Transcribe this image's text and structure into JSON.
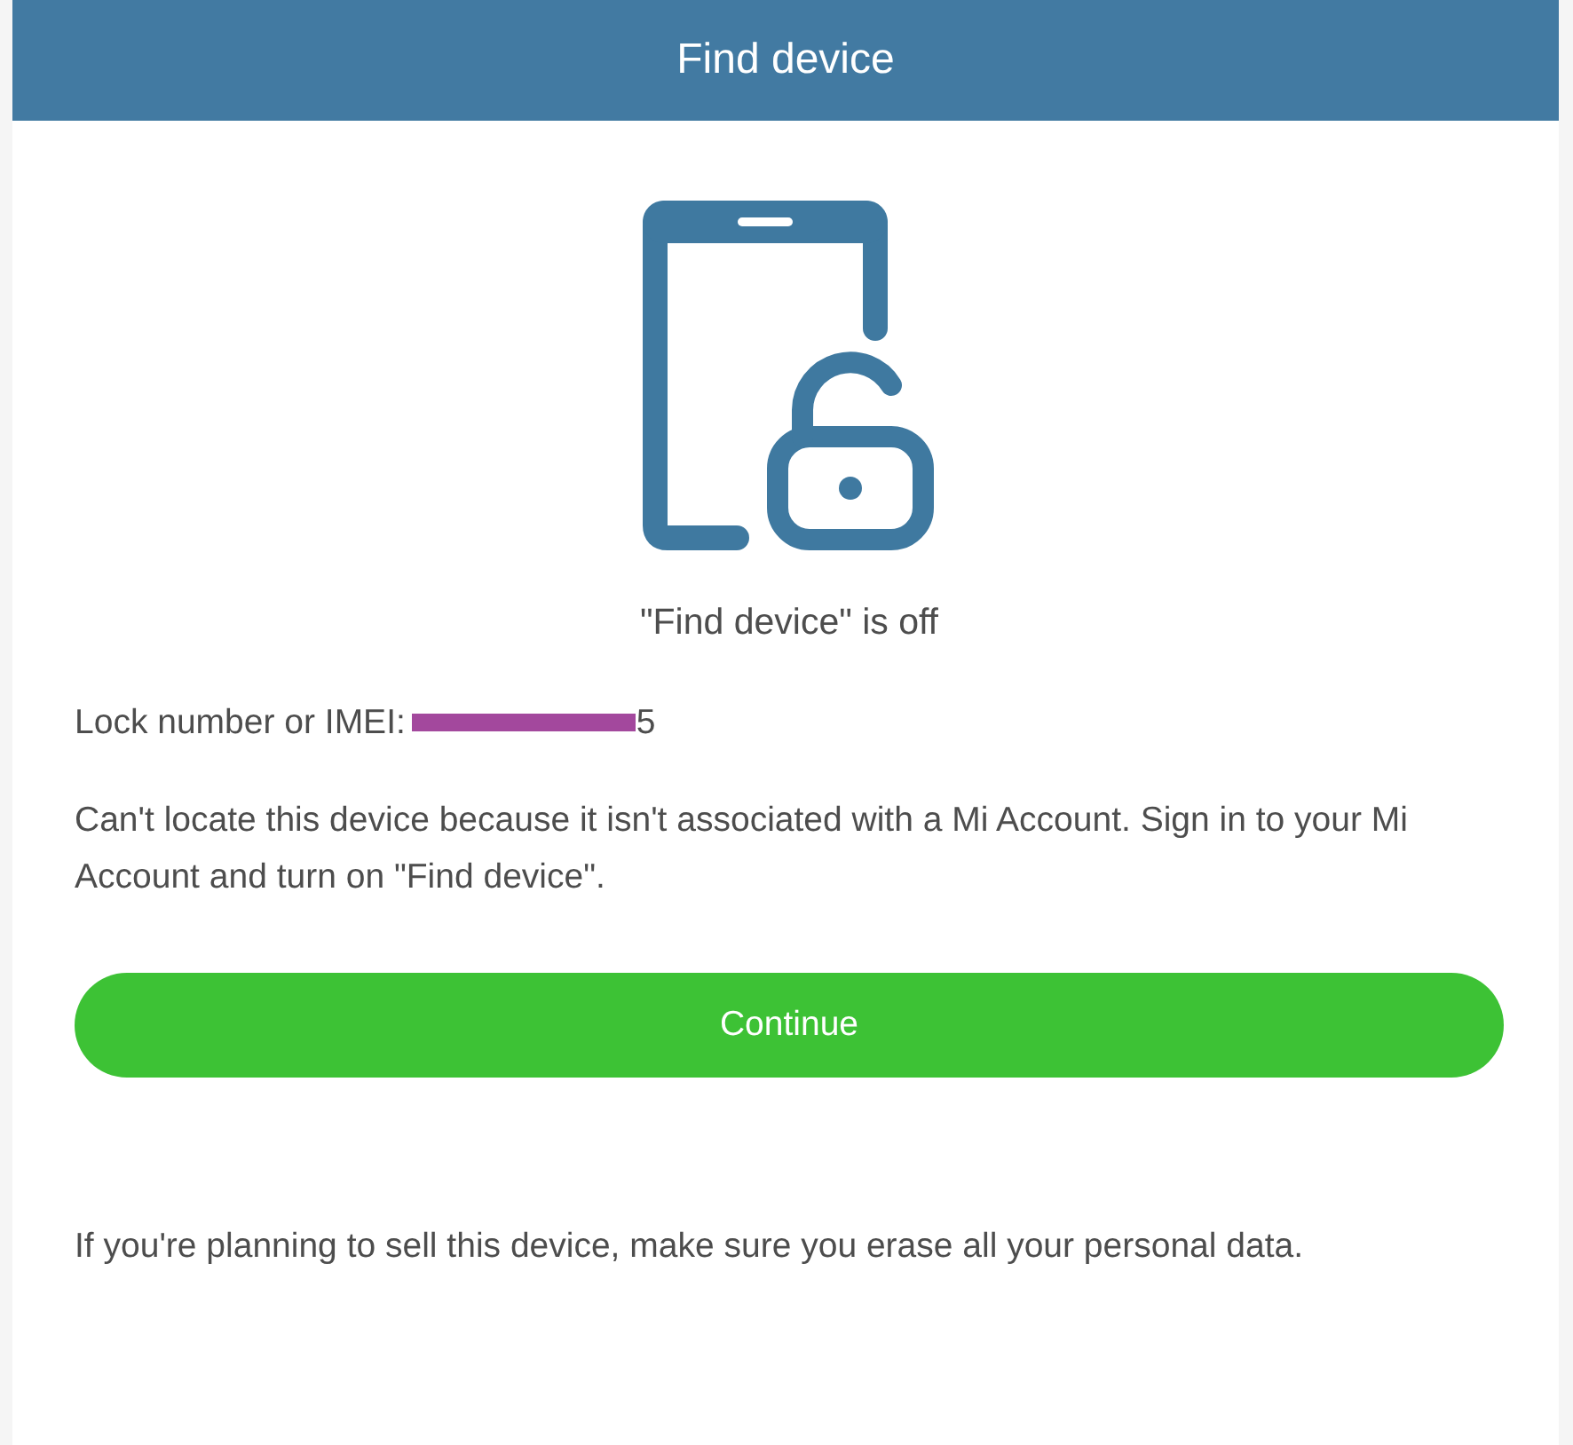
{
  "header": {
    "title": "Find device"
  },
  "status": {
    "text": "\"Find device\" is off"
  },
  "lock_info": {
    "label": "Lock number or IMEI:",
    "redacted": true,
    "value_visible": "5"
  },
  "message": "Can't locate this device because it isn't associated with a Mi Account. Sign in to your Mi Account and turn on \"Find device\".",
  "buttons": [
    {
      "label": "Continue"
    }
  ],
  "footer_note": "If you're planning to sell this device, make sure you erase all your personal data."
}
